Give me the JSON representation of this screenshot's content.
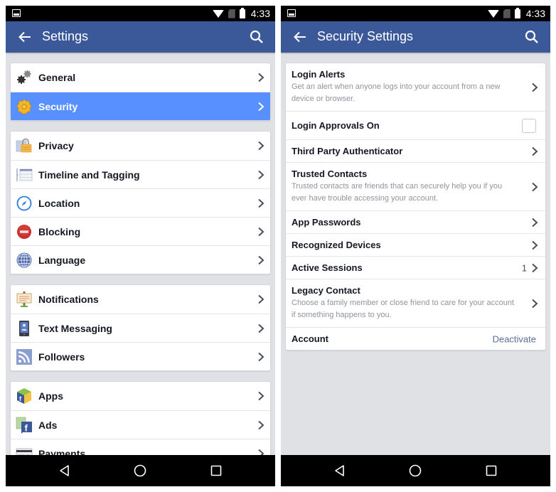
{
  "status_bar": {
    "time": "4:33"
  },
  "colors": {
    "app_bar": "#3b5998",
    "selected_row": "#5890ff",
    "background": "#e0e1e5",
    "deactivate_link": "#5b6f94"
  },
  "left": {
    "title": "Settings",
    "groups": [
      [
        {
          "label": "General",
          "icon": "gears-icon",
          "selected": false
        },
        {
          "label": "Security",
          "icon": "security-badge-icon",
          "selected": true
        }
      ],
      [
        {
          "label": "Privacy",
          "icon": "privacy-lock-icon"
        },
        {
          "label": "Timeline and Tagging",
          "icon": "timeline-icon"
        },
        {
          "label": "Location",
          "icon": "compass-icon"
        },
        {
          "label": "Blocking",
          "icon": "blocking-icon"
        },
        {
          "label": "Language",
          "icon": "globe-icon"
        }
      ],
      [
        {
          "label": "Notifications",
          "icon": "notifications-sign-icon"
        },
        {
          "label": "Text Messaging",
          "icon": "phone-icon"
        },
        {
          "label": "Followers",
          "icon": "rss-icon"
        }
      ],
      [
        {
          "label": "Apps",
          "icon": "apps-cube-icon"
        },
        {
          "label": "Ads",
          "icon": "ads-icon"
        },
        {
          "label": "Payments",
          "icon": "credit-card-icon"
        }
      ]
    ]
  },
  "right": {
    "title": "Security Settings",
    "items": [
      {
        "title": "Login Alerts",
        "desc": "Get an alert when anyone logs into your account from a new device or browser."
      },
      {
        "title": "Login Approvals On",
        "checked": false
      },
      {
        "title": "Third Party Authenticator"
      },
      {
        "title": "Trusted Contacts",
        "desc": "Trusted contacts are friends that can securely help you if you ever have trouble accessing your account."
      },
      {
        "title": "App Passwords"
      },
      {
        "title": "Recognized Devices"
      },
      {
        "title": "Active Sessions",
        "count": "1"
      },
      {
        "title": "Legacy Contact",
        "desc": "Choose a family member or close friend to care for your account if something happens to you."
      },
      {
        "title": "Account",
        "action": "Deactivate"
      }
    ]
  }
}
